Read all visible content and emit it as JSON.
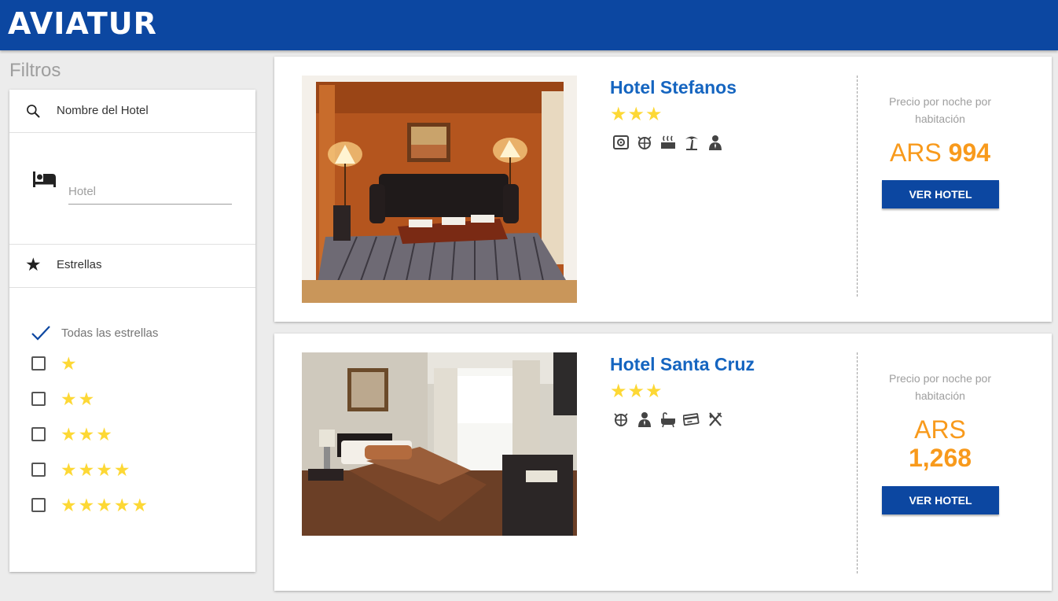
{
  "header": {
    "brand": "AVIATUR",
    "brand_color": "#0c47a1"
  },
  "filters": {
    "title": "Filtros",
    "search_name_label": "Nombre del Hotel",
    "hotel_input_placeholder": "Hotel",
    "stars_label": "Estrellas",
    "all_stars_label": "Todas las estrellas",
    "star_options": [
      1,
      2,
      3,
      4,
      5
    ]
  },
  "hotels": [
    {
      "name": "Hotel Stefanos",
      "stars": 3,
      "amenities": [
        "safe-box-icon",
        "globe-icon",
        "hot-tub-icon",
        "beach-icon",
        "concierge-icon"
      ],
      "price_note": "Precio por noche por habitación",
      "currency": "ARS",
      "price": "994",
      "button": "VER HOTEL"
    },
    {
      "name": "Hotel Santa Cruz",
      "stars": 3,
      "amenities": [
        "globe-icon",
        "concierge-icon",
        "bathtub-icon",
        "credit-card-icon",
        "restaurant-icon"
      ],
      "price_note": "Precio por noche por habitación",
      "currency": "ARS",
      "price": "1,268",
      "button": "VER HOTEL"
    }
  ],
  "colors": {
    "accent": "#0c47a1",
    "link": "#1565c0",
    "price": "#f89a1c",
    "star": "#fdd835"
  }
}
